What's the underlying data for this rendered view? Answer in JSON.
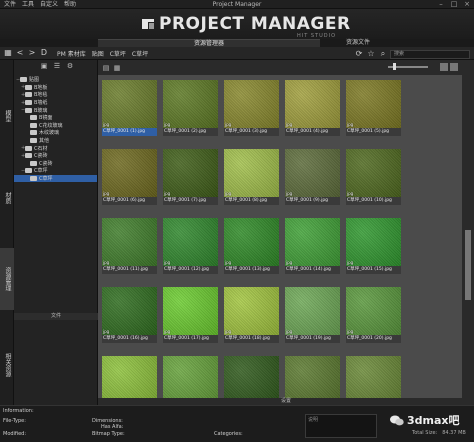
{
  "window": {
    "menu": [
      "文件",
      "工具",
      "自定义",
      "帮助"
    ],
    "title": "Project Manager",
    "controls": [
      "–",
      "□",
      "×"
    ]
  },
  "banner": {
    "logo": "PROJECT MANAGER",
    "sub": "HIT STUDIO"
  },
  "tabs": {
    "main": "资源管理器",
    "side": "资源文件"
  },
  "nav": {
    "back": "<",
    "forward": ">",
    "folder": "D",
    "breadcrumbs": [
      "PM 素材库",
      "贴图",
      "C草坪",
      "C草坪"
    ],
    "search_placeholder": "搜索"
  },
  "vertical_tabs": [
    {
      "label": "模型",
      "active": false
    },
    {
      "label": "材质",
      "active": false
    },
    {
      "label": "资源管理",
      "active": true
    },
    {
      "label": "相关资源",
      "active": false
    }
  ],
  "tree": {
    "toolbar_icons": [
      "folder-add-icon",
      "list-icon",
      "settings-icon"
    ],
    "nodes": [
      {
        "label": "贴图",
        "depth": 0,
        "expanded": "−",
        "selected": false
      },
      {
        "label": "B地板",
        "depth": 1,
        "expanded": "+",
        "selected": false
      },
      {
        "label": "B地毯",
        "depth": 1,
        "expanded": "+",
        "selected": false
      },
      {
        "label": "B墙纸",
        "depth": 1,
        "expanded": "+",
        "selected": false
      },
      {
        "label": "B玻璃",
        "depth": 1,
        "expanded": "−",
        "selected": false
      },
      {
        "label": "B镜面",
        "depth": 2,
        "expanded": "",
        "selected": false
      },
      {
        "label": "C花纹玻璃",
        "depth": 2,
        "expanded": "",
        "selected": false
      },
      {
        "label": "木纹玻璃",
        "depth": 2,
        "expanded": "",
        "selected": false
      },
      {
        "label": "其他",
        "depth": 2,
        "expanded": "",
        "selected": false
      },
      {
        "label": "C石材",
        "depth": 1,
        "expanded": "+",
        "selected": false
      },
      {
        "label": "C瓷砖",
        "depth": 1,
        "expanded": "+",
        "selected": false
      },
      {
        "label": "C瓷砖",
        "depth": 2,
        "expanded": "",
        "selected": false
      },
      {
        "label": "C草坪",
        "depth": 1,
        "expanded": "−",
        "selected": false
      },
      {
        "label": "C草坪",
        "depth": 2,
        "expanded": "",
        "selected": true
      }
    ],
    "footer_label": "文件"
  },
  "content": {
    "status": "设置",
    "files": [
      {
        "name": "C草坪_0001 (1).jpg",
        "ext": "jpg",
        "color": "#6b7e2a"
      },
      {
        "name": "C草坪_0001 (2).jpg",
        "ext": "jpg",
        "color": "#5d7a23"
      },
      {
        "name": "C草坪_0001 (3).jpg",
        "ext": "jpg",
        "color": "#8a8a2c"
      },
      {
        "name": "C草坪_0001 (4).jpg",
        "ext": "jpg",
        "color": "#a3a13c"
      },
      {
        "name": "C草坪_0001 (5).jpg",
        "ext": "jpg",
        "color": "#7e7a22"
      },
      {
        "name": "C草坪_0001 (6).jpg",
        "ext": "jpg",
        "color": "#6f6a1e"
      },
      {
        "name": "C草坪_0001 (7).jpg",
        "ext": "jpg",
        "color": "#3e5e16"
      },
      {
        "name": "C草坪_0001 (8).jpg",
        "ext": "jpg",
        "color": "#a3c24a"
      },
      {
        "name": "C草坪_0001 (9).jpg",
        "ext": "jpg",
        "color": "#5d6d3a"
      },
      {
        "name": "C草坪_0001 (10).jpg",
        "ext": "jpg",
        "color": "#4f6a1e"
      },
      {
        "name": "C草坪_0001 (11).jpg",
        "ext": "jpg",
        "color": "#3f7f2a"
      },
      {
        "name": "C草坪_0001 (12).jpg",
        "ext": "jpg",
        "color": "#2f8a2c"
      },
      {
        "name": "C草坪_0001 (13).jpg",
        "ext": "jpg",
        "color": "#2e8c26"
      },
      {
        "name": "C草坪_0001 (14).jpg",
        "ext": "jpg",
        "color": "#3fa336"
      },
      {
        "name": "C草坪_0001 (15).jpg",
        "ext": "jpg",
        "color": "#2f9a2e"
      },
      {
        "name": "C草坪_0001 (16).jpg",
        "ext": "jpg",
        "color": "#2e6e1e"
      },
      {
        "name": "C草坪_0001 (17).jpg",
        "ext": "jpg",
        "color": "#6ccf2e"
      },
      {
        "name": "C草坪_0001 (18).jpg",
        "ext": "jpg",
        "color": "#a4c83e"
      },
      {
        "name": "C草坪_0001 (19).jpg",
        "ext": "jpg",
        "color": "#6eaa56"
      },
      {
        "name": "C草坪_0001 (20).jpg",
        "ext": "jpg",
        "color": "#5a9a3c"
      },
      {
        "name": "C草坪_0001 (21).jpg",
        "ext": "jpg",
        "color": "#8ec43a"
      },
      {
        "name": "C草坪_0001 (22).jpg",
        "ext": "jpg",
        "color": "#66a43a"
      },
      {
        "name": "C草坪_0001 (23).jpg",
        "ext": "jpg",
        "color": "#2e5a1a"
      },
      {
        "name": "C草坪_0001 (24).jpg",
        "ext": "jpg",
        "color": "#5b7a2e"
      },
      {
        "name": "C草坪_0001 (25).jpg",
        "ext": "jpg",
        "color": "#6a8a36"
      }
    ]
  },
  "info": {
    "title": "Information:",
    "file_type": "File-Type:",
    "modified": "Modified:",
    "dimensions": "Dimensions:",
    "has_alfa": "Has Alfa:",
    "bitmap_type": "Bitmap Type:",
    "categories": "Categories:",
    "notes_placeholder": "说明",
    "total_size_label": "Total Size:",
    "total_size": "84.37 MB"
  },
  "watermark": "3dmax吧"
}
